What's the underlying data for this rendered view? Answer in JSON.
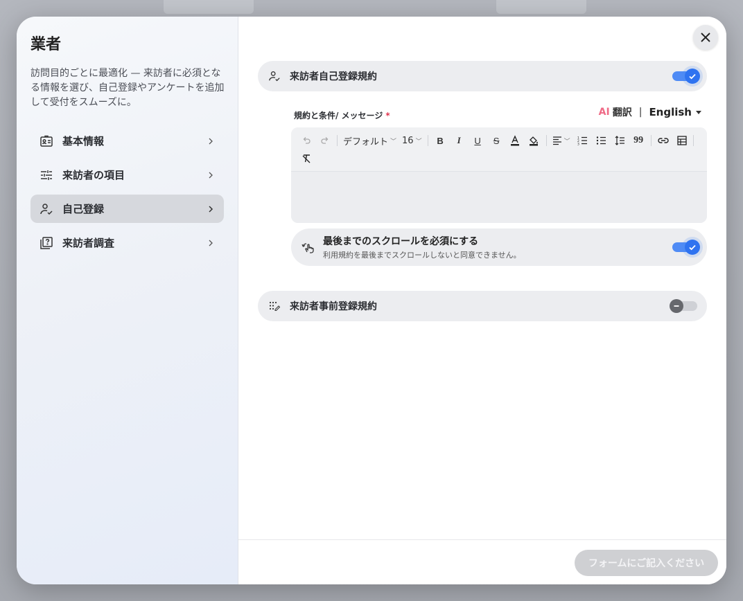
{
  "left": {
    "title": "業者",
    "description": "訪問目的ごとに最適化 — 来訪者に必須となる情報を選び、自己登録やアンケートを追加して受付をスムーズに。",
    "nav": [
      {
        "label": "基本情報",
        "icon": "id-card-icon",
        "active": false
      },
      {
        "label": "来訪者の項目",
        "icon": "sliders-icon",
        "active": false
      },
      {
        "label": "自己登録",
        "icon": "user-check-icon",
        "active": true
      },
      {
        "label": "来訪者調査",
        "icon": "survey-icon",
        "active": false
      }
    ]
  },
  "right": {
    "self_registration": {
      "label": "来訪者自己登録規約",
      "enabled": true
    },
    "field_label": "規約と条件/ メッセージ",
    "required_mark": "*",
    "lang": {
      "ai": "AI",
      "translate": "翻訳",
      "separator": "|",
      "language": "English"
    },
    "toolbar": {
      "font": "デフォルト",
      "size": "16"
    },
    "scroll_option": {
      "title": "最後までのスクロールを必須にする",
      "description": "利用規約を最後までスクロールしないと同意できません。",
      "enabled": true
    },
    "pre_registration": {
      "label": "来訪者事前登録規約",
      "enabled": false
    },
    "submit_label": "フォームにご記入ください"
  },
  "colors": {
    "accent": "#2f73f0",
    "required": "#e0344e",
    "ai": "#ef6a86"
  }
}
